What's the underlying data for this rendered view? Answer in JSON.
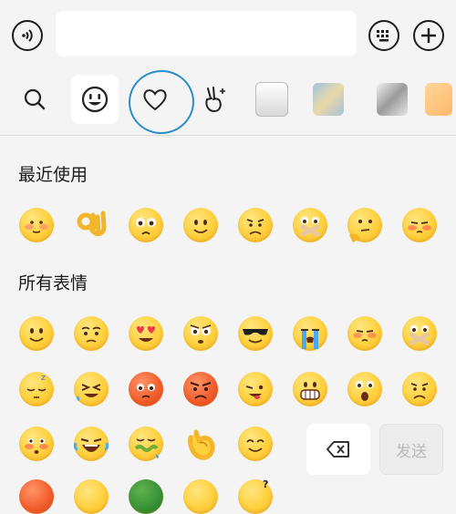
{
  "input": {
    "value": "",
    "placeholder": ""
  },
  "tabs": [
    "search-icon",
    "smiley-icon",
    "heart-icon",
    "gesture-icon",
    "sticker-1",
    "sticker-2",
    "sticker-3",
    "sticker-4"
  ],
  "panel": {
    "recent_title": "最近使用",
    "all_title": "所有表情",
    "recent": [
      "blush",
      "ok-hand",
      "worried",
      "smile",
      "frown",
      "hush",
      "think",
      "shy"
    ],
    "all": [
      [
        "smile",
        "worried",
        "heart-eyes",
        "angry-eyes",
        "cool",
        "cry",
        "shy",
        "hush"
      ],
      [
        "sleep",
        "grin-sweat",
        "red-angry",
        "red-angry",
        "wink",
        "grin",
        "surprise",
        "frown"
      ],
      [
        "blush",
        "laugh-cry",
        "sick",
        "hand-think",
        "happy"
      ],
      [
        "red-face",
        "grin",
        "green",
        "smile",
        "question"
      ]
    ]
  },
  "bottom": {
    "send_label": "发送"
  },
  "colors": {
    "background": "#f4f4f4",
    "annotation": "#2a8ec8",
    "emoji_yellow": "#ffd03d"
  }
}
